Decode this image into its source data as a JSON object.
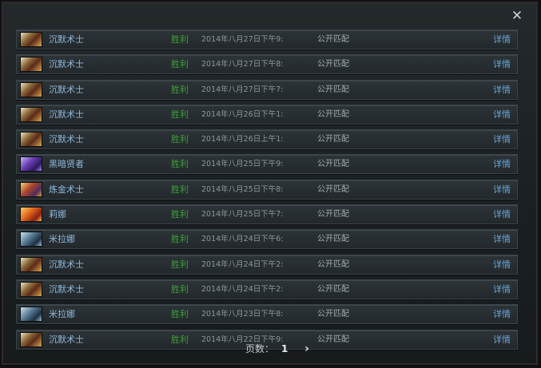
{
  "dialog": {
    "close_icon": "close-icon",
    "close_glyph": "✕"
  },
  "matches": [
    {
      "hero": "沉默术士",
      "hero_icon": "silencer",
      "result": "胜利",
      "date": "2014年八月27日下午9:",
      "mode": "公开匹配",
      "details": "详情"
    },
    {
      "hero": "沉默术士",
      "hero_icon": "silencer",
      "result": "胜利",
      "date": "2014年八月27日下午8:",
      "mode": "公开匹配",
      "details": "详情"
    },
    {
      "hero": "沉默术士",
      "hero_icon": "silencer",
      "result": "胜利",
      "date": "2014年八月27日下午7:",
      "mode": "公开匹配",
      "details": "详情"
    },
    {
      "hero": "沉默术士",
      "hero_icon": "silencer",
      "result": "胜利",
      "date": "2014年八月26日下午1:",
      "mode": "公开匹配",
      "details": "详情"
    },
    {
      "hero": "沉默术士",
      "hero_icon": "silencer",
      "result": "胜利",
      "date": "2014年八月26日上午1:",
      "mode": "公开匹配",
      "details": "详情"
    },
    {
      "hero": "黑暗贤者",
      "hero_icon": "dark-seer",
      "result": "胜利",
      "date": "2014年八月25日下午9:",
      "mode": "公开匹配",
      "details": "详情"
    },
    {
      "hero": "炼金术士",
      "hero_icon": "alchemist",
      "result": "胜利",
      "date": "2014年八月25日下午8:",
      "mode": "公开匹配",
      "details": "详情"
    },
    {
      "hero": "莉娜",
      "hero_icon": "lina",
      "result": "胜利",
      "date": "2014年八月25日下午7:",
      "mode": "公开匹配",
      "details": "详情"
    },
    {
      "hero": "米拉娜",
      "hero_icon": "mirana",
      "result": "胜利",
      "date": "2014年八月24日下午6:",
      "mode": "公开匹配",
      "details": "详情"
    },
    {
      "hero": "沉默术士",
      "hero_icon": "silencer",
      "result": "胜利",
      "date": "2014年八月24日下午2:",
      "mode": "公开匹配",
      "details": "详情"
    },
    {
      "hero": "沉默术士",
      "hero_icon": "silencer",
      "result": "胜利",
      "date": "2014年八月24日下午2:",
      "mode": "公开匹配",
      "details": "详情"
    },
    {
      "hero": "米拉娜",
      "hero_icon": "mirana",
      "result": "胜利",
      "date": "2014年八月23日下午8:",
      "mode": "公开匹配",
      "details": "详情"
    },
    {
      "hero": "沉默术士",
      "hero_icon": "silencer",
      "result": "胜利",
      "date": "2014年八月22日下午9:",
      "mode": "公开匹配",
      "details": "详情"
    }
  ],
  "pager": {
    "label": "页数：",
    "current_page": "1",
    "next_icon": "chevron-right-icon",
    "next_glyph": "›"
  },
  "colors": {
    "victory": "#3e9c3a",
    "hero_name": "#8fb7da",
    "details_link": "#6aa6d9"
  }
}
